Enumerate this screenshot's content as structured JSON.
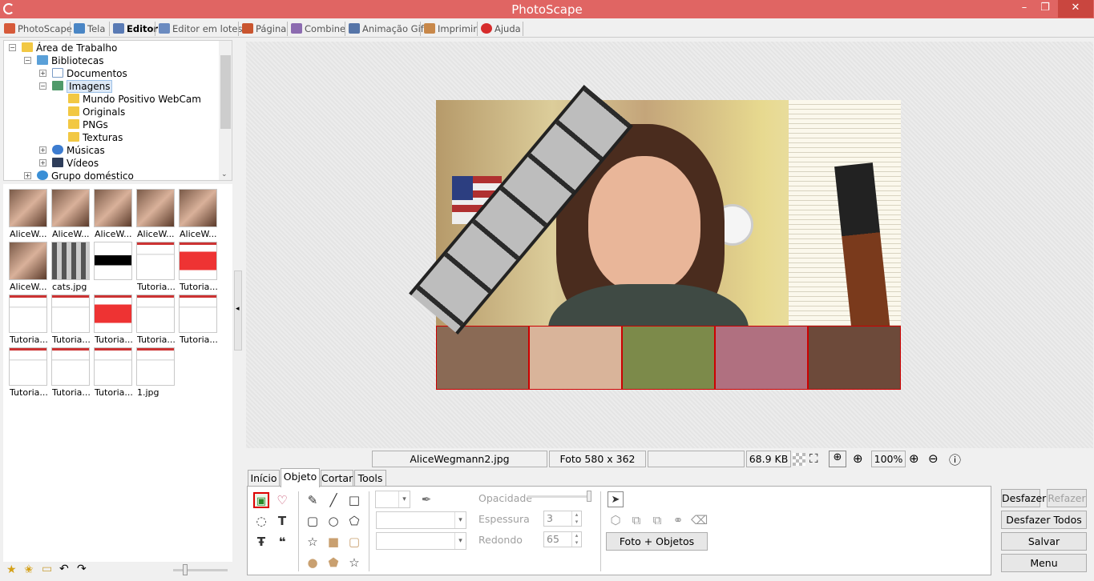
{
  "window": {
    "title": "PhotoScape",
    "minimize": "–",
    "maximize": "❐",
    "close": "✕"
  },
  "menu": {
    "tabs": [
      {
        "label": "PhotoScape",
        "color": "#d65a3a"
      },
      {
        "label": "Tela",
        "color": "#4a86c5"
      },
      {
        "label": "Editor",
        "color": "#5a7bb5",
        "active": true
      },
      {
        "label": "Editor em lotes",
        "color": "#6b8bc0"
      },
      {
        "label": "Página",
        "color": "#c9552f"
      },
      {
        "label": "Combine",
        "color": "#8c6bb0"
      },
      {
        "label": "Animação Gif",
        "color": "#5675a8"
      },
      {
        "label": "Imprimir",
        "color": "#c8884a"
      },
      {
        "label": "Ajuda",
        "color": "#d62b2b"
      }
    ]
  },
  "tree": {
    "items": [
      {
        "label": "Área de Trabalho"
      },
      {
        "label": "Bibliotecas"
      },
      {
        "label": "Documentos"
      },
      {
        "label": "Imagens",
        "selected": true
      },
      {
        "label": "Mundo Positivo WebCam"
      },
      {
        "label": "Originals"
      },
      {
        "label": "PNGs"
      },
      {
        "label": "Texturas"
      },
      {
        "label": "Músicas"
      },
      {
        "label": "Vídeos"
      },
      {
        "label": "Grupo doméstico"
      }
    ]
  },
  "thumbnails": [
    {
      "label": "AliceW...",
      "kind": "face"
    },
    {
      "label": "AliceW...",
      "kind": "face"
    },
    {
      "label": "AliceW...",
      "kind": "face"
    },
    {
      "label": "AliceW...",
      "kind": "face"
    },
    {
      "label": "AliceW...",
      "kind": "face"
    },
    {
      "label": "AliceW...",
      "kind": "face"
    },
    {
      "label": "cats.jpg",
      "kind": "strip"
    },
    {
      "label": "",
      "kind": "black"
    },
    {
      "label": "Tutoria...",
      "kind": "tut"
    },
    {
      "label": "Tutoria...",
      "kind": "red"
    },
    {
      "label": "Tutoria...",
      "kind": "tut"
    },
    {
      "label": "Tutoria...",
      "kind": "tut"
    },
    {
      "label": "Tutoria...",
      "kind": "red"
    },
    {
      "label": "Tutoria...",
      "kind": "tut"
    },
    {
      "label": "Tutoria...",
      "kind": "tut"
    },
    {
      "label": "Tutoria...",
      "kind": "tut"
    },
    {
      "label": "Tutoria...",
      "kind": "tut"
    },
    {
      "label": "Tutoria...",
      "kind": "tut"
    },
    {
      "label": "1.jpg",
      "kind": "tut"
    }
  ],
  "status": {
    "filename": "AliceWegmann2.jpg",
    "dimensions": "Foto 580 x 362",
    "extra": "",
    "filesize": "68.9 KB",
    "zoom": "100%"
  },
  "editor_tabs": [
    {
      "label": "Início"
    },
    {
      "label": "Objeto",
      "active": true
    },
    {
      "label": "Cortar"
    },
    {
      "label": "Tools"
    }
  ],
  "object_panel": {
    "opacity_label": "Opacidade",
    "opacity_value": 1.0,
    "thickness_label": "Espessura",
    "thickness_value": "3",
    "round_label": "Redondo",
    "round_value": "65",
    "photo_objects_button": "Foto + Objetos"
  },
  "actions": {
    "undo": "Desfazer",
    "redo": "Refazer",
    "undo_all": "Desfazer Todos",
    "save": "Salvar",
    "menu": "Menu"
  }
}
